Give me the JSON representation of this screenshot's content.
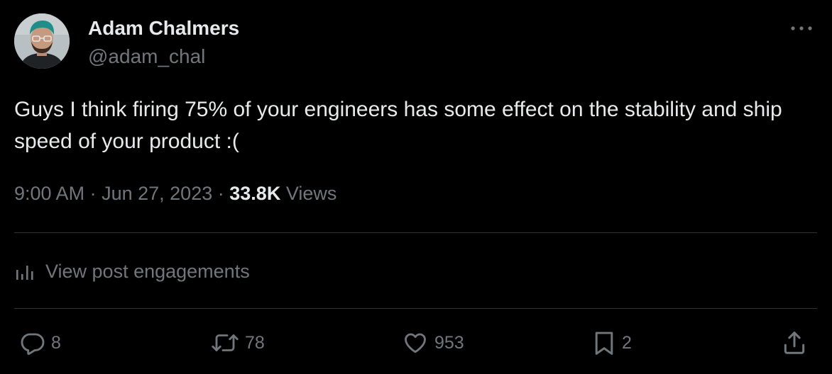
{
  "author": {
    "name": "Adam Chalmers",
    "handle": "@adam_chal"
  },
  "tweet": {
    "text": "Guys I think firing 75% of your engineers has some effect on the stability and ship speed of your product :("
  },
  "meta": {
    "time": "9:00 AM",
    "separator": "·",
    "date": "Jun 27, 2023",
    "views_count": "33.8K",
    "views_label": "Views"
  },
  "engagements": {
    "label": "View post engagements"
  },
  "actions": {
    "replies": "8",
    "reposts": "78",
    "likes": "953",
    "bookmarks": "2"
  },
  "colors": {
    "background": "#000000",
    "primary_text": "#e7e9ea",
    "secondary_text": "#71767b",
    "divider": "#2f3336"
  },
  "icons": {
    "more": "more-icon",
    "engagements": "analytics-icon",
    "reply": "reply-icon",
    "repost": "repost-icon",
    "like": "heart-icon",
    "bookmark": "bookmark-icon",
    "share": "share-icon"
  }
}
